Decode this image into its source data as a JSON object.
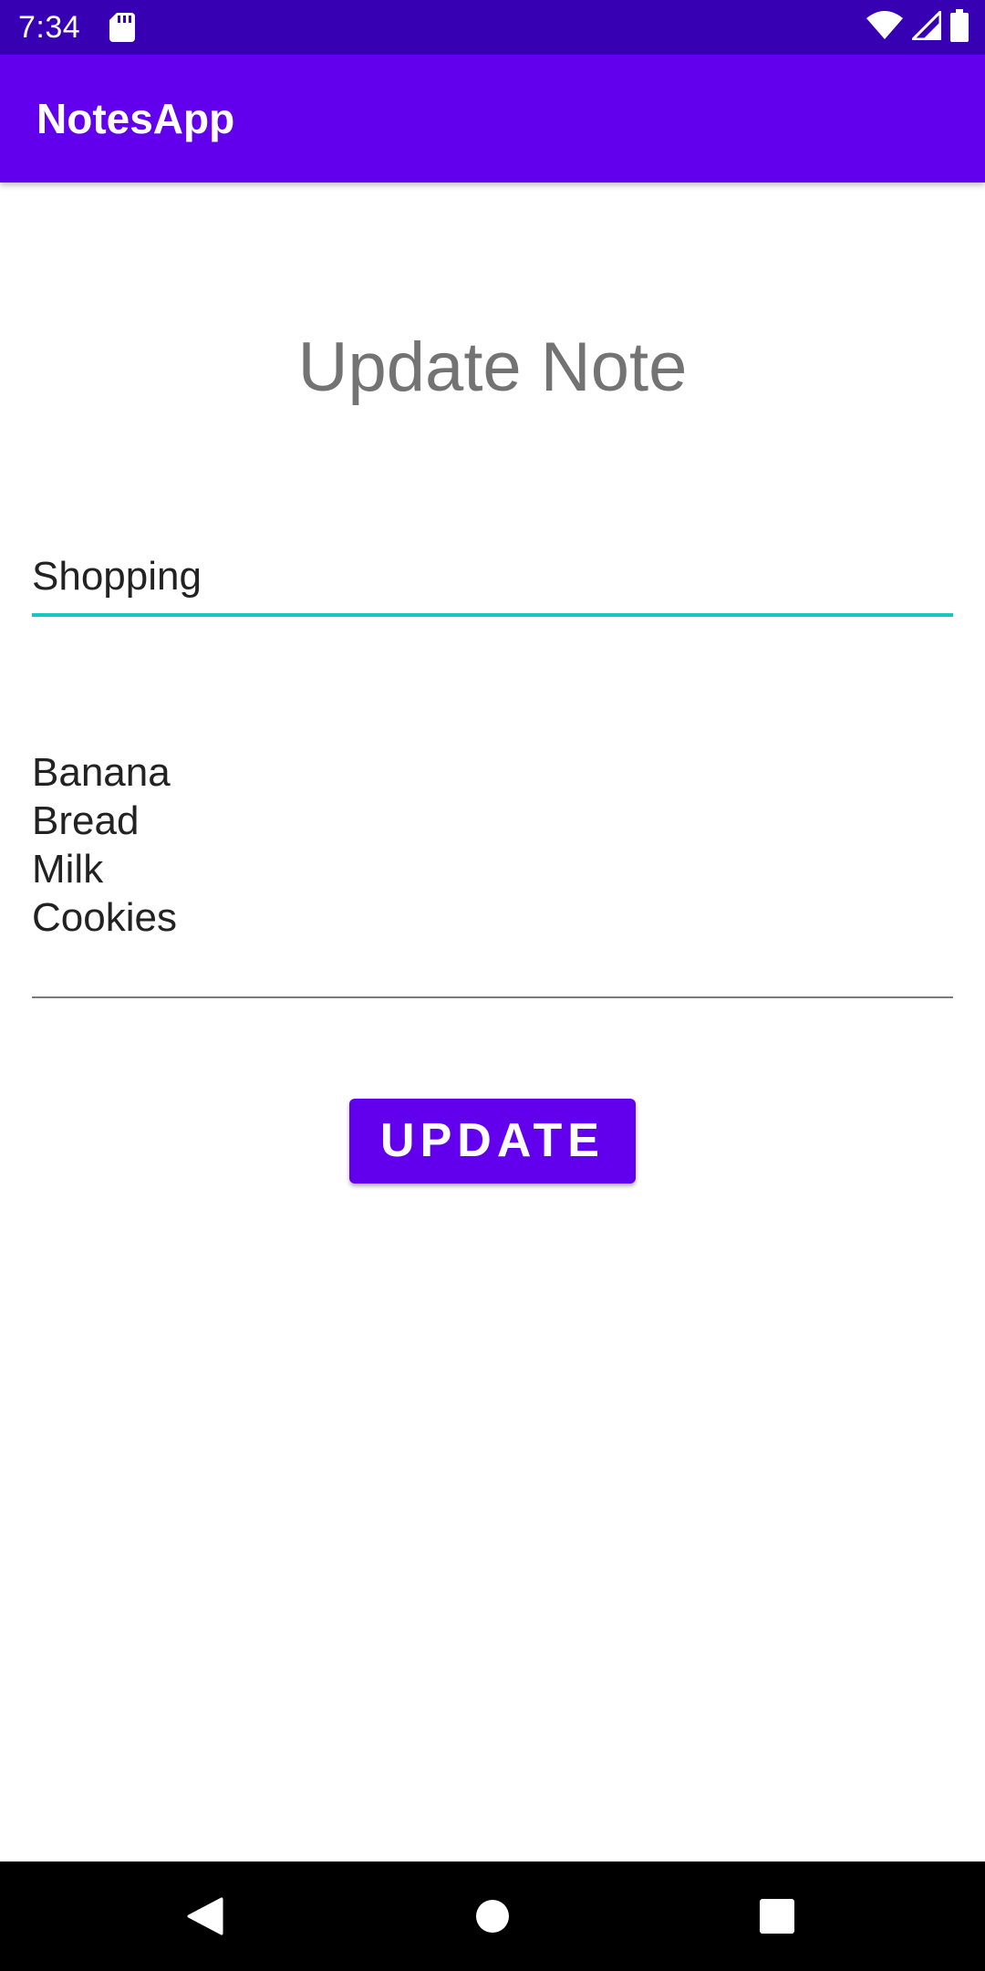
{
  "status_bar": {
    "time": "7:34",
    "icons": [
      "sd-card-icon",
      "wifi-icon",
      "signal-icon",
      "battery-icon"
    ]
  },
  "app_bar": {
    "title": "NotesApp"
  },
  "page": {
    "heading": "Update Note",
    "title_field": {
      "value": "Shopping"
    },
    "body_field": {
      "lines": [
        "Banana",
        "Bread",
        "Milk",
        "Cookies"
      ]
    },
    "update_button_label": "UPDATE"
  },
  "nav_bar": {
    "icons": [
      "back-icon",
      "home-icon",
      "recents-icon"
    ]
  },
  "colors": {
    "status_bar": "#3700b3",
    "primary": "#6200ee",
    "accent_underline": "#18c6c0",
    "heading_text": "#737373",
    "body_text": "#222222"
  }
}
